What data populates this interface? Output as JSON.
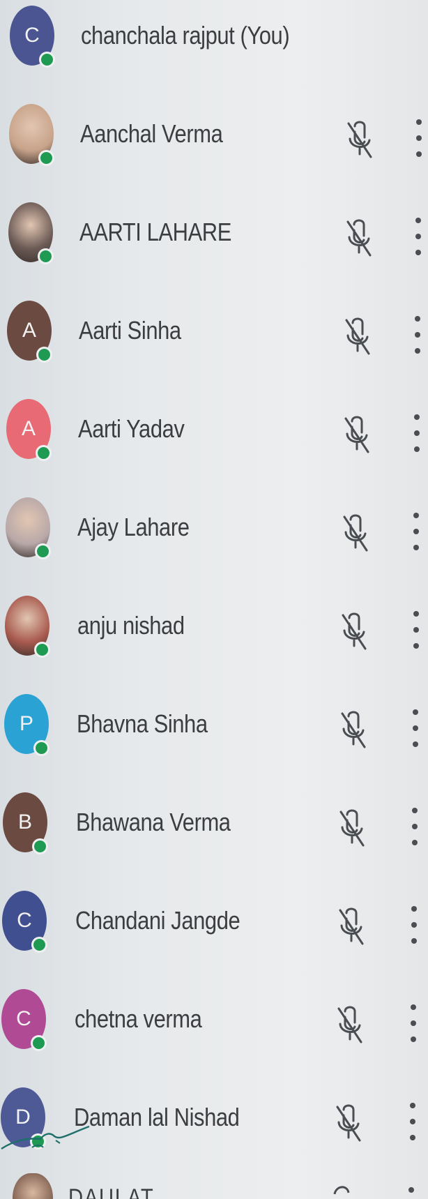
{
  "participants": [
    {
      "name": "chanchala rajput (You)",
      "avatar_type": "letter",
      "initial": "C",
      "avatar_color": "#4a5591",
      "muted": false,
      "has_menu": false
    },
    {
      "name": "Aanchal Verma",
      "avatar_type": "photo",
      "initial": "",
      "avatar_color": "#c8a38a",
      "muted": true,
      "has_menu": true
    },
    {
      "name": "AARTI LAHARE",
      "avatar_type": "photo",
      "initial": "",
      "avatar_color": "#6b5a55",
      "muted": true,
      "has_menu": true
    },
    {
      "name": "Aarti Sinha",
      "avatar_type": "letter",
      "initial": "A",
      "avatar_color": "#6b4a42",
      "muted": true,
      "has_menu": true
    },
    {
      "name": "Aarti Yadav",
      "avatar_type": "letter",
      "initial": "A",
      "avatar_color": "#e86a74",
      "muted": true,
      "has_menu": true
    },
    {
      "name": "Ajay Lahare",
      "avatar_type": "photo",
      "initial": "",
      "avatar_color": "#b8a8a8",
      "muted": true,
      "has_menu": true
    },
    {
      "name": "anju nishad",
      "avatar_type": "photo",
      "initial": "",
      "avatar_color": "#a85a4e",
      "muted": true,
      "has_menu": true
    },
    {
      "name": "Bhavna Sinha",
      "avatar_type": "letter",
      "initial": "P",
      "avatar_color": "#2aa3d4",
      "muted": true,
      "has_menu": true
    },
    {
      "name": "Bhawana Verma",
      "avatar_type": "letter",
      "initial": "B",
      "avatar_color": "#6b4a42",
      "muted": true,
      "has_menu": true
    },
    {
      "name": "Chandani Jangde",
      "avatar_type": "letter",
      "initial": "C",
      "avatar_color": "#3f4f8f",
      "muted": true,
      "has_menu": true
    },
    {
      "name": "chetna verma",
      "avatar_type": "letter",
      "initial": "C",
      "avatar_color": "#b04a94",
      "muted": true,
      "has_menu": true
    },
    {
      "name": "Daman lal Nishad",
      "avatar_type": "letter",
      "initial": "D",
      "avatar_color": "#4d5a96",
      "muted": true,
      "has_menu": true
    }
  ],
  "partial_row_name": "DAULAT",
  "colors": {
    "status_online": "#1f9a52",
    "text": "#3b3d41",
    "icon": "#4a4d52"
  },
  "icons": {
    "mic_off": "mic-off-icon",
    "more": "more-vert-icon"
  }
}
